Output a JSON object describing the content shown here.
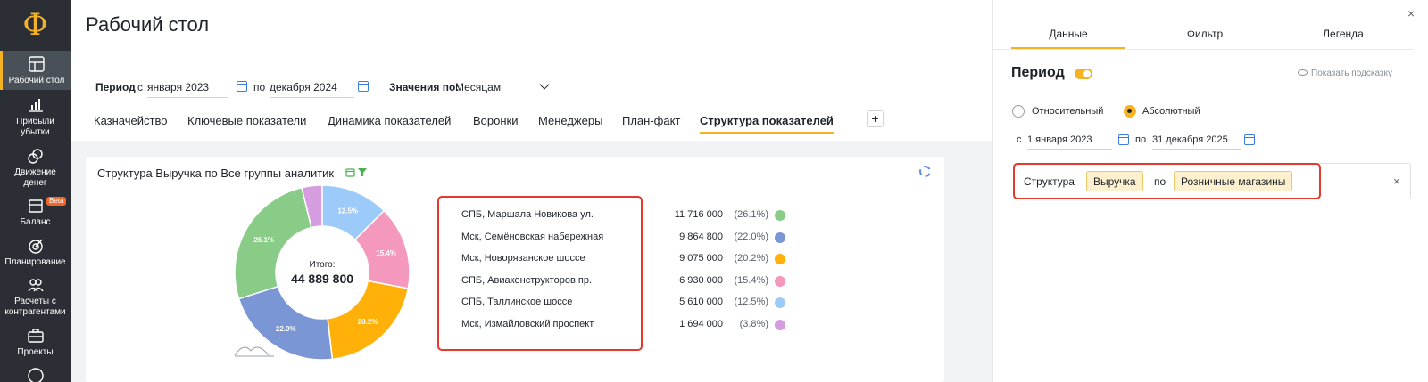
{
  "sidebar": {
    "logo": "Ф",
    "items": [
      {
        "label": "Рабочий стол",
        "icon": "dashboard-icon",
        "active": true
      },
      {
        "label": "Прибыли убытки",
        "icon": "bar-chart-icon"
      },
      {
        "label": "Движение денег",
        "icon": "money-flow-icon"
      },
      {
        "label": "Баланс",
        "icon": "balance-icon",
        "badge": "Beta"
      },
      {
        "label": "Планирование",
        "icon": "target-icon"
      },
      {
        "label": "Расчеты с контрагентами",
        "icon": "people-icon"
      },
      {
        "label": "Проекты",
        "icon": "briefcase-icon"
      }
    ]
  },
  "header": {
    "title": "Рабочий стол"
  },
  "filters": {
    "period_label": "Период",
    "from_prefix": "с",
    "from_value": "января 2023",
    "to_prefix": "по",
    "to_value": "декабря 2024",
    "values_label": "Значения по:",
    "values_value": "Месяцам"
  },
  "tabs": [
    {
      "label": "Казначейство"
    },
    {
      "label": "Ключевые показатели"
    },
    {
      "label": "Динамика показателей"
    },
    {
      "label": "Воронки"
    },
    {
      "label": "Менеджеры"
    },
    {
      "label": "План-факт"
    },
    {
      "label": "Структура показателей",
      "active": true
    }
  ],
  "tab_add": "+",
  "card": {
    "title": "Структура Выручка по Все группы аналитик",
    "total_label": "Итого:",
    "total_value": "44 889 800"
  },
  "colors": {
    "accent": "#f5b324",
    "highlight_border": "#e23b2e",
    "sidebar_bg": "#2b2f35"
  },
  "chart_data": {
    "type": "pie",
    "variant": "donut",
    "series": [
      {
        "label": "СПБ, Маршала Новикова ул.",
        "value": 11716000,
        "value_text": "11 716 000",
        "percent": "(26.1%)",
        "slice_label": "26.1%",
        "color": "#88cc88"
      },
      {
        "label": "Мск, Семёновская набережная",
        "value": 9864800,
        "value_text": "9 864 800",
        "percent": "(22.0%)",
        "slice_label": "22.0%",
        "color": "#7b96d4"
      },
      {
        "label": "Мск, Новорязанское шоссе",
        "value": 9075000,
        "value_text": "9 075 000",
        "percent": "(20.2%)",
        "slice_label": "20.2%",
        "color": "#ffb10a"
      },
      {
        "label": "СПБ, Авиаконструкторов пр.",
        "value": 6930000,
        "value_text": "6 930 000",
        "percent": "(15.4%)",
        "slice_label": "15.4%",
        "color": "#f598be"
      },
      {
        "label": "СПБ, Таллинское шоссе",
        "value": 5610000,
        "value_text": "5 610 000",
        "percent": "(12.5%)",
        "slice_label": "12.5%",
        "color": "#9ccbfa"
      },
      {
        "label": "Мск, Измайловский проспект",
        "value": 1694000,
        "value_text": "1 694 000",
        "percent": "(3.8%)",
        "slice_label": "",
        "color": "#d59ce0"
      }
    ],
    "total": 44889800,
    "legend_position": "right"
  },
  "panel": {
    "tabs": [
      "Данные",
      "Фильтр",
      "Легенда"
    ],
    "title": "Период",
    "hint": "Показать подсказку",
    "radio_relative": "Относительный",
    "radio_absolute": "Абсолютный",
    "from_prefix": "с",
    "from_value": "1 января 2023",
    "to_prefix": "по",
    "to_value": "31 декабря 2025",
    "structure_label": "Структура",
    "structure_chip": "Выручка",
    "by_label": "по",
    "by_chip": "Розничные магазины",
    "clear": "×",
    "close": "×"
  }
}
